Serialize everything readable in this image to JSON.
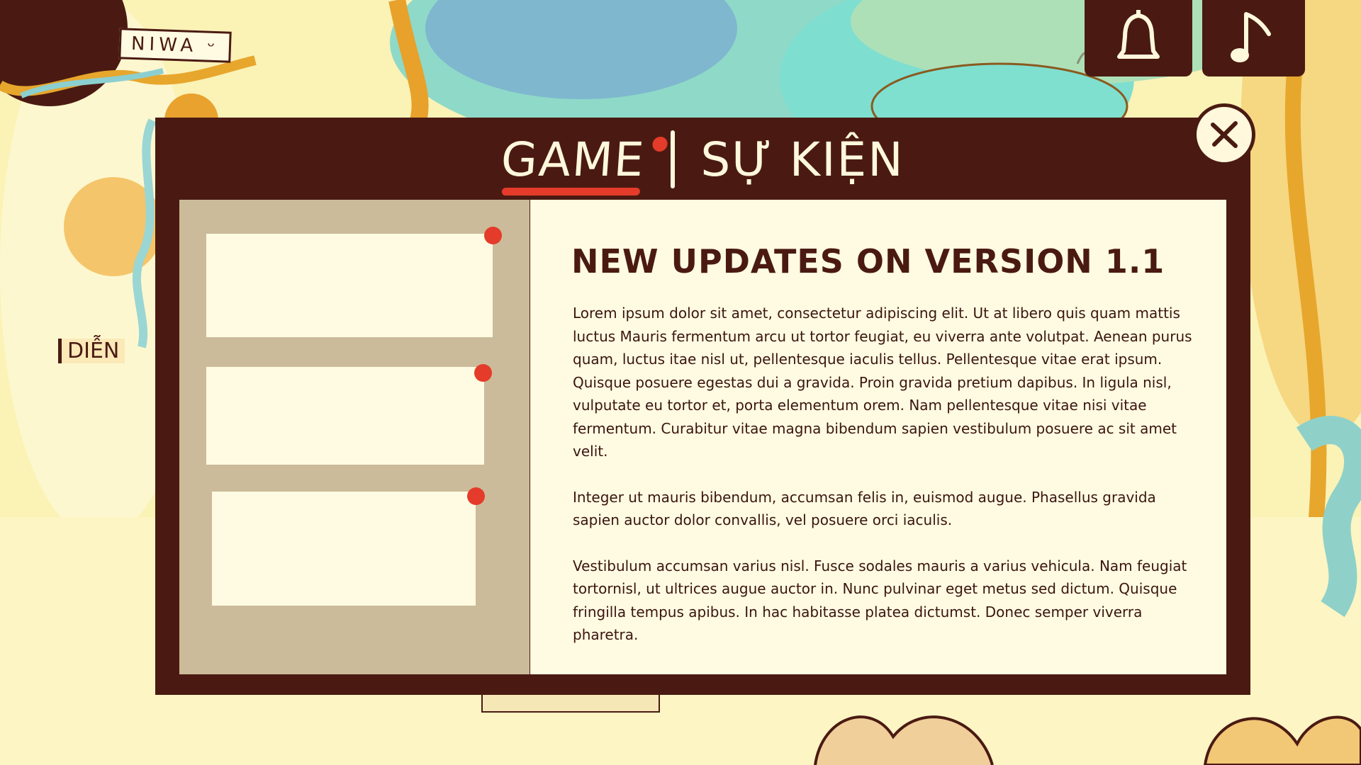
{
  "hud": {
    "player_name": "NIWA ᵕ",
    "location_label": "DIỄN",
    "notification_icon": "bell-icon",
    "music_icon": "music-note-icon"
  },
  "modal": {
    "tabs": [
      {
        "label": "GAME",
        "active": true,
        "has_notification": true
      },
      {
        "label": "SỰ KIỆN",
        "active": false,
        "has_notification": false
      }
    ],
    "close_icon": "close-icon",
    "updates_list": [
      {
        "title": "",
        "unread": true
      },
      {
        "title": "",
        "unread": true
      },
      {
        "title": "",
        "unread": true
      }
    ],
    "article": {
      "title": "NEW UPDATES ON VERSION 1.1",
      "paragraphs": [
        "Lorem ipsum dolor sit amet, consectetur adipiscing elit. Ut at libero quis quam mattis luctus Mauris fermentum arcu ut tortor feugiat, eu viverra ante volutpat. Aenean purus quam, luctus itae nisl ut, pellentesque iaculis tellus. Pellentesque vitae erat ipsum. Quisque posuere egestas dui a gravida. Proin gravida pretium dapibus. In ligula nisl, vulputate eu tortor et, porta elementum orem. Nam pellentesque vitae nisi vitae fermentum. Curabitur vitae magna bibendum sapien vestibulum posuere ac sit amet velit.",
        "Integer ut mauris bibendum, accumsan felis in, euismod augue. Phasellus gravida sapien auctor dolor convallis, vel posuere orci iaculis.",
        "Vestibulum accumsan varius nisl. Fusce sodales mauris a varius vehicula. Nam feugiat tortornisl, ut ultrices augue auctor in. Nunc pulvinar eget metus sed dictum. Quisque fringilla tempus apibus. In hac habitasse platea dictumst. Donec semper viverra pharetra."
      ]
    }
  },
  "colors": {
    "frame": "#4a1a12",
    "paper": "#fffbe2",
    "list_bg": "#cbbb9a",
    "accent_red": "#e53b2a"
  }
}
